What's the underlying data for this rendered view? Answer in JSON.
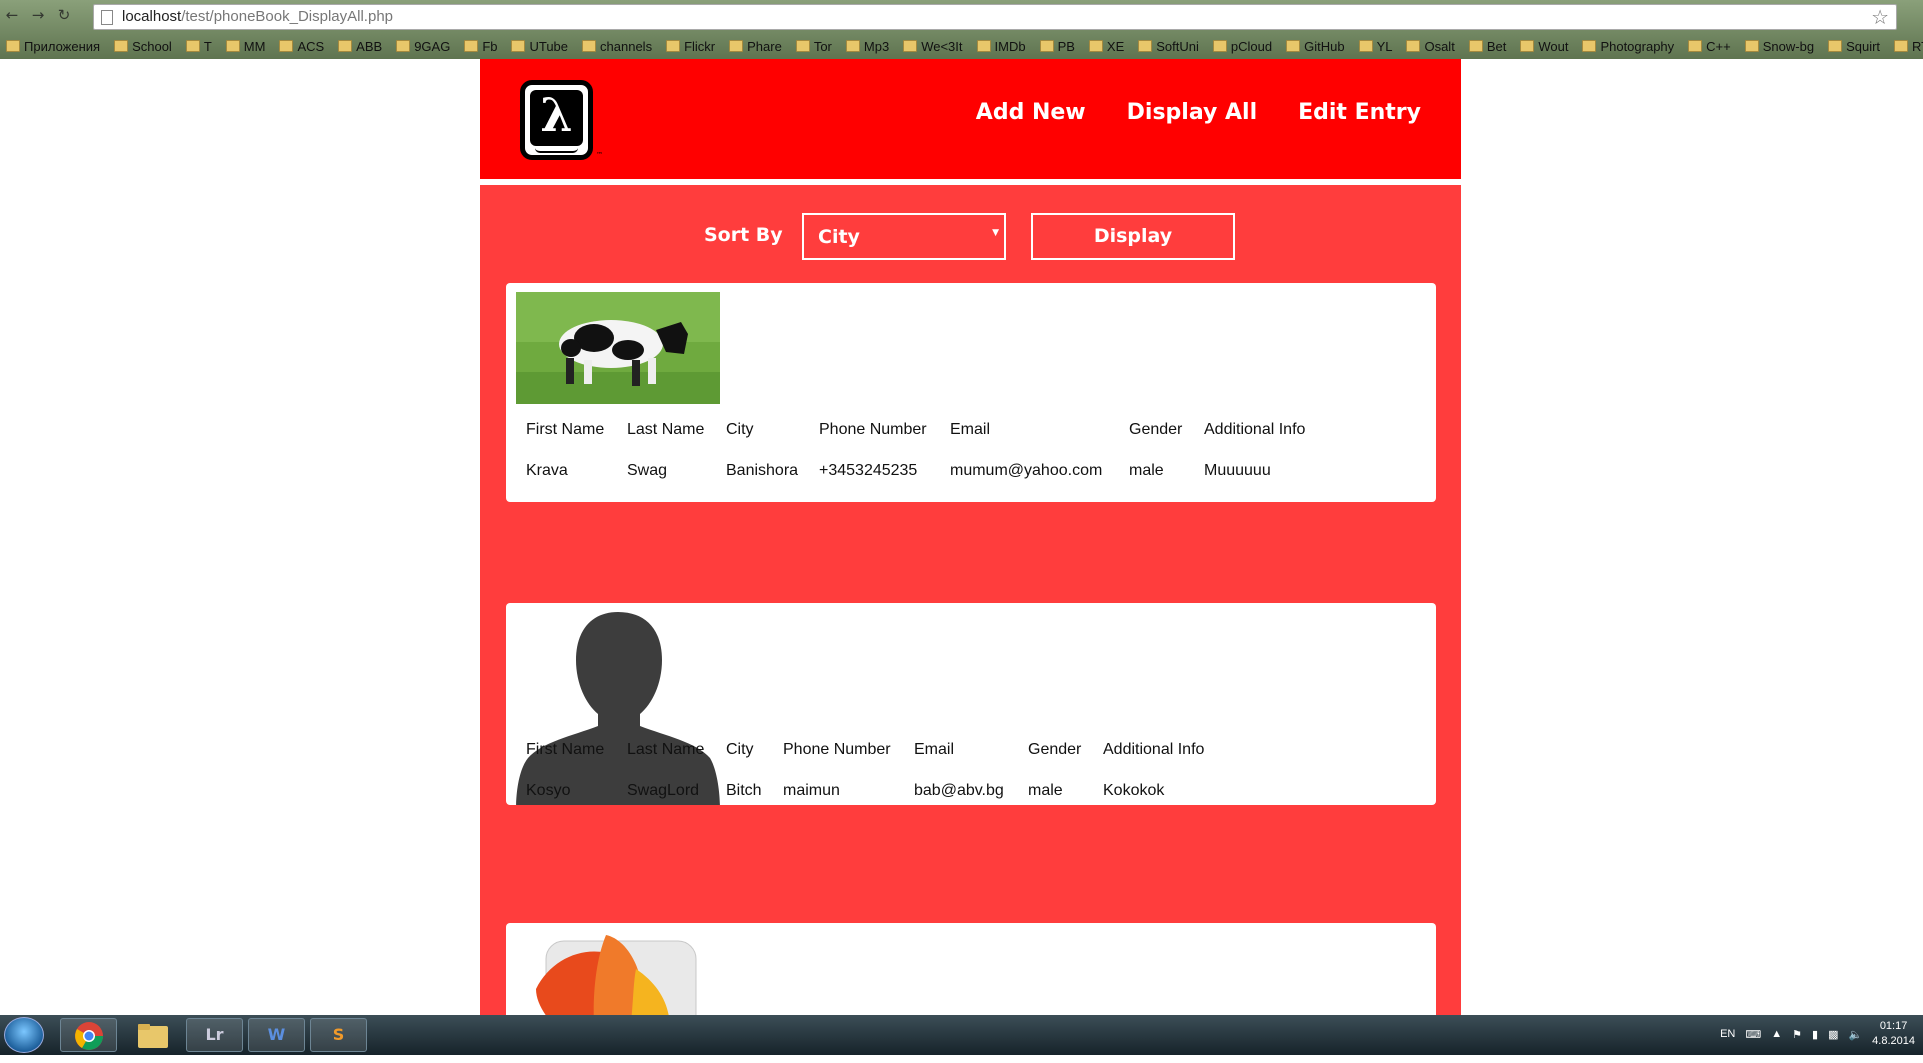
{
  "browser": {
    "url_host": "localhost",
    "url_path": "/test/phoneBook_DisplayAll.php",
    "bookmarks": [
      "Приложения",
      "School",
      "T",
      "MM",
      "ACS",
      "ABB",
      "9GAG",
      "Fb",
      "UTube",
      "channels",
      "Flickr",
      "Phare",
      "Tor",
      "Mp3",
      "We<3It",
      "IMDb",
      "PB",
      "XE",
      "SoftUni",
      "pCloud",
      "GitHub",
      "YL",
      "Osalt",
      "Bet",
      "Wout",
      "Photography",
      "C++",
      "Snow-bg",
      "Squirt",
      "RT"
    ]
  },
  "site": {
    "nav": {
      "add_new": "Add New",
      "display_all": "Display All",
      "edit_entry": "Edit Entry"
    },
    "sort": {
      "label": "Sort By",
      "selected": "City",
      "button": "Display"
    },
    "columns": [
      "First Name",
      "Last Name",
      "City",
      "Phone Number",
      "Email",
      "Gender",
      "Additional Info"
    ],
    "entries": [
      {
        "photo": "cow-photo",
        "first_name": "Krava",
        "last_name": "Swag",
        "city": "Banishora",
        "phone": "+3453245235",
        "email": "mumum@yahoo.com",
        "gender": "male",
        "info": "Muuuuuu"
      },
      {
        "photo": "person-silhouette",
        "first_name": "Kosyo",
        "last_name": "SwagLord",
        "city": "Bitch",
        "phone": "maimun",
        "email": "bab@abv.bg",
        "gender": "male",
        "info": "Kokokok"
      },
      {
        "photo": "feather-app-icon"
      }
    ]
  },
  "taskbar": {
    "apps": [
      "chrome-icon",
      "explorer-icon",
      "lightroom-icon",
      "word-icon",
      "sublime-icon"
    ],
    "lr_label": "Lr",
    "word_label": "W",
    "sublime_label": "S",
    "language": "EN",
    "time": "01:17",
    "date": "4.8.2014"
  }
}
